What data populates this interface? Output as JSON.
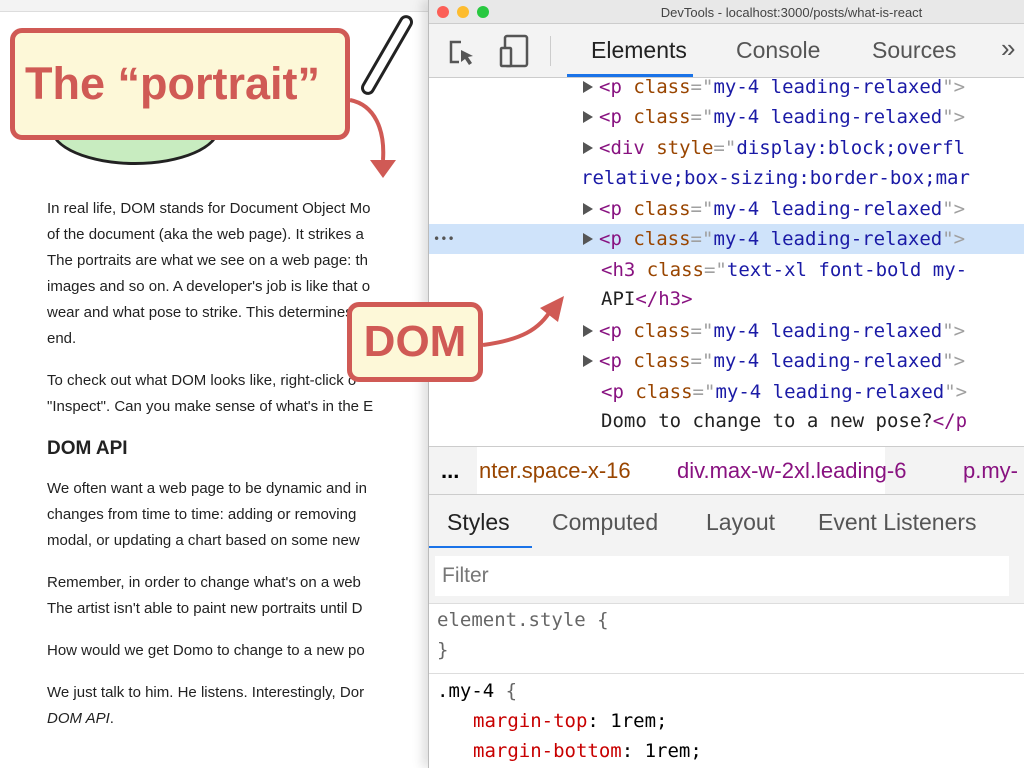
{
  "article": {
    "p1": [
      "In real life, DOM stands for Document Object Mo",
      "of the document (aka the web page). It strikes a",
      "The portraits are what we see on a web page: th",
      "images and so on. A developer's job is like that o",
      "wear and what pose to strike. This determines w",
      "end."
    ],
    "p2": [
      "To check out what DOM looks like, right-click o",
      "\"Inspect\". Can you make sense of what's in the E"
    ],
    "heading": "DOM API",
    "p3": [
      "We often want a web page to be dynamic and in",
      "changes from time to time: adding or removing",
      "modal, or updating a chart based on some new"
    ],
    "p4": [
      "Remember, in order to change what's on a web",
      "The artist isn't able to paint new portraits until D"
    ],
    "p5": [
      "How would we get Domo to change to a new po"
    ],
    "p6": [
      "We just talk to him. He listens. Interestingly, Dor"
    ],
    "p6_em": "DOM API",
    "p6_end": "."
  },
  "callouts": {
    "portrait": "The “portrait”",
    "dom": "DOM",
    "color": "#d05a55",
    "bg": "#fdf8d8"
  },
  "devtools": {
    "title": "DevTools - localhost:3000/posts/what-is-react",
    "tabs": [
      "Elements",
      "Console",
      "Sources"
    ],
    "more": "»",
    "tree": {
      "p_open": "<p",
      "class_attr": "class",
      "eq": "=\"",
      "class_val": "my-4 leading-relaxed",
      "close": "\">",
      "div_tag": "<div",
      "style_attr": "style",
      "div_val": "display:block;overfl",
      "div_wrap": "relative;box-sizing:border-box;mar",
      "h3_tag": "<h3",
      "h3_val": "text-xl font-bold my-",
      "h3_text": "API",
      "h3_close": "</h3>",
      "p_text": "Domo to change to a new pose?",
      "p_close": "</p",
      "dots": "•••"
    },
    "breadcrumb": {
      "ellipsis": "...",
      "items": [
        "nter.space-x-16",
        "div.max-w-2xl.leading-6",
        "p.my-"
      ]
    },
    "subtabs": [
      "Styles",
      "Computed",
      "Layout",
      "Event Listeners"
    ],
    "filter_placeholder": "Filter",
    "styles": {
      "element_style": "element.style {",
      "close_brace": "}",
      "selector": ".my-4",
      "open": " {",
      "props": [
        {
          "name": "margin-top",
          "value": " 1rem;"
        },
        {
          "name": "margin-bottom",
          "value": " 1rem;"
        }
      ]
    },
    "colors": {
      "accent": "#1a73e8",
      "tag": "#881280",
      "attr": "#994500",
      "value": "#1a1aa6",
      "selected": "#cfe3fa"
    }
  }
}
